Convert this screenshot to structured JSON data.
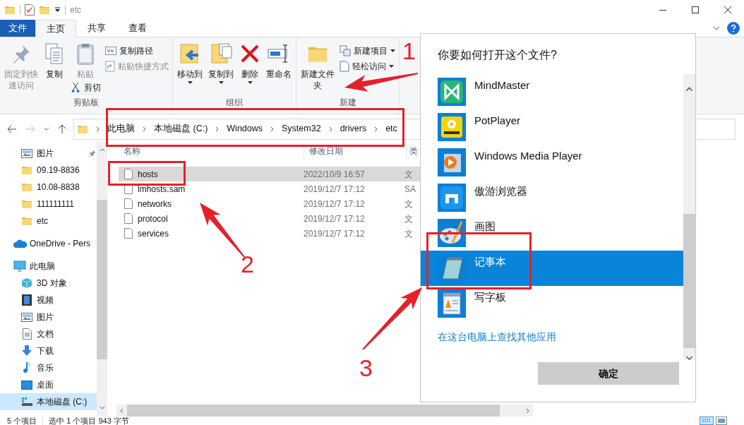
{
  "window": {
    "title": "etc"
  },
  "ribbon_tabs": [
    {
      "label": "文件",
      "kind": "file",
      "selected": false
    },
    {
      "label": "主页",
      "kind": "tab",
      "selected": true
    },
    {
      "label": "共享",
      "kind": "tab",
      "selected": false
    },
    {
      "label": "查看",
      "kind": "tab",
      "selected": false
    }
  ],
  "ribbon_groups": [
    {
      "label": "剪贴板",
      "columns": [
        [
          {
            "label": "固定到快速访问",
            "kind": "large",
            "disabled": true,
            "dropdown": false
          }
        ],
        [
          {
            "label": "复制",
            "kind": "large",
            "disabled": false,
            "dropdown": false
          }
        ],
        [
          {
            "label": "粘贴",
            "kind": "large",
            "disabled": true,
            "dropdown": false
          },
          {
            "label": "剪切",
            "kind": "small",
            "disabled": false,
            "dropdown": false
          }
        ],
        [
          {
            "label": "复制路径",
            "kind": "small",
            "disabled": false,
            "dropdown": false
          },
          {
            "label": "粘贴快捷方式",
            "kind": "small",
            "disabled": true,
            "dropdown": false
          }
        ]
      ]
    },
    {
      "label": "组织",
      "columns": [
        [
          {
            "label": "移动到",
            "kind": "large",
            "disabled": false,
            "dropdown": true
          }
        ],
        [
          {
            "label": "复制到",
            "kind": "large",
            "disabled": false,
            "dropdown": true
          }
        ],
        [
          {
            "label": "删除",
            "kind": "large",
            "disabled": false,
            "dropdown": true
          }
        ],
        [
          {
            "label": "重命名",
            "kind": "large",
            "disabled": false,
            "dropdown": false
          }
        ]
      ]
    },
    {
      "label": "新建",
      "columns": [
        [
          {
            "label": "新建文件夹",
            "kind": "large",
            "disabled": false,
            "dropdown": false
          }
        ],
        [
          {
            "label": "新建项目",
            "kind": "small",
            "disabled": false,
            "dropdown": true
          },
          {
            "label": "轻松访问",
            "kind": "small",
            "disabled": false,
            "dropdown": true
          }
        ]
      ]
    }
  ],
  "breadcrumbs": [
    "此电脑",
    "本地磁盘 (C:)",
    "Windows",
    "System32",
    "drivers",
    "etc"
  ],
  "sidebar": {
    "items": [
      {
        "label": "图片",
        "kind": "pictures",
        "pinned": true,
        "selected": false
      },
      {
        "label": "09.19-8836",
        "kind": "folder",
        "pinned": false,
        "selected": false
      },
      {
        "label": "10.08-8838",
        "kind": "folder",
        "pinned": false,
        "selected": false
      },
      {
        "label": "111111111",
        "kind": "folder",
        "pinned": false,
        "selected": false
      },
      {
        "label": "etc",
        "kind": "folder",
        "pinned": false,
        "selected": false
      },
      {
        "label": "OneDrive - Pers",
        "kind": "onedrive",
        "pinned": false,
        "selected": false
      },
      {
        "label": "此电脑",
        "kind": "pc",
        "pinned": false,
        "selected": false,
        "children": [
          {
            "label": "3D 对象",
            "kind": "cube",
            "selected": false
          },
          {
            "label": "视频",
            "kind": "video",
            "selected": false
          },
          {
            "label": "图片",
            "kind": "pictures",
            "selected": false
          },
          {
            "label": "文档",
            "kind": "document",
            "selected": false
          },
          {
            "label": "下载",
            "kind": "download",
            "selected": false
          },
          {
            "label": "音乐",
            "kind": "music",
            "selected": false
          },
          {
            "label": "桌面",
            "kind": "desktop",
            "selected": false
          },
          {
            "label": "本地磁盘 (C:)",
            "kind": "disk",
            "selected": true
          }
        ]
      }
    ]
  },
  "file_list": {
    "columns": [
      "名称",
      "修改日期",
      "类"
    ],
    "rows": [
      {
        "name": "hosts",
        "modified": "2022/10/9 16:57",
        "column_3": "文",
        "selected": true
      },
      {
        "name": "lmhosts.sam",
        "modified": "2019/12/7 17:12",
        "column_3": "SA",
        "selected": false
      },
      {
        "name": "networks",
        "modified": "2019/12/7 17:12",
        "column_3": "文",
        "selected": false
      },
      {
        "name": "protocol",
        "modified": "2019/12/7 17:12",
        "column_3": "文",
        "selected": false
      },
      {
        "name": "services",
        "modified": "2019/12/7 17:12",
        "column_3": "文",
        "selected": false
      }
    ]
  },
  "status_bar": {
    "count": "5 个项目",
    "selection": "选中 1 个项目  943 字节"
  },
  "dialog": {
    "title": "你要如何打开这个文件?",
    "apps": [
      {
        "name": "MindMaster",
        "selected": false
      },
      {
        "name": "PotPlayer",
        "selected": false
      },
      {
        "name": "Windows Media Player",
        "selected": false
      },
      {
        "name": "傲游浏览器",
        "selected": false
      },
      {
        "name": "画图",
        "selected": false
      },
      {
        "name": "记事本",
        "selected": true
      },
      {
        "name": "写字板",
        "selected": false
      }
    ],
    "link": "在这台电脑上查找其他应用",
    "button": "确定"
  },
  "annotations": [
    {
      "label": "1"
    },
    {
      "label": "2"
    },
    {
      "label": "3"
    }
  ]
}
